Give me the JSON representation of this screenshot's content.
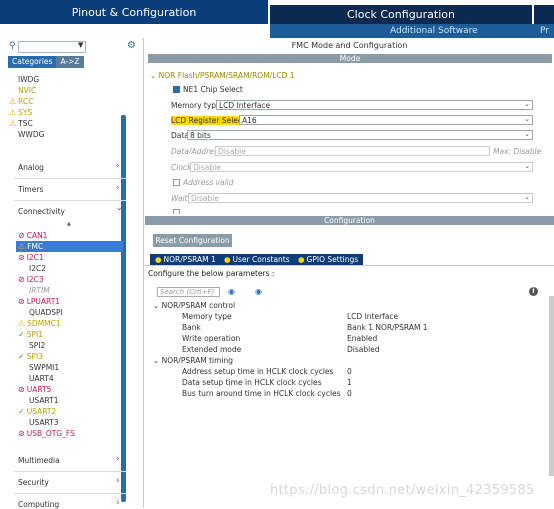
{
  "header": {
    "tab_pinout": "Pinout & Configuration",
    "tab_clock": "Clock Configuration",
    "additional_software": "Additional Software",
    "right_fragment": "Pr"
  },
  "left": {
    "cat_tab_a": "Categories",
    "cat_tab_b": "A->Z",
    "items_top": [
      "IWDG",
      "NVIC",
      "RCC",
      "SYS",
      "TSC",
      "WWDG"
    ],
    "categories": {
      "analog": "Analog",
      "timers": "Timers",
      "connectivity": "Connectivity",
      "multimedia": "Multimedia",
      "security": "Security",
      "computing": "Computing"
    },
    "connectivity_items": [
      "CAN1",
      "FMC",
      "I2C1",
      "I2C2",
      "I2C3",
      "IRTIM",
      "LPUART1",
      "QUADSPI",
      "SDMMC1",
      "SPI1",
      "SPI2",
      "SPI3",
      "SWPMI1",
      "UART4",
      "UART5",
      "USART1",
      "USART2",
      "USART3",
      "USB_OTG_FS"
    ]
  },
  "mode": {
    "title": "FMC Mode and Configuration",
    "bar": "Mode",
    "nor_header": "NOR Flash/PSRAM/SRAM/ROM/LCD 1",
    "ne1": "NE1 Chip Select",
    "memory_type_label": "Memory type",
    "memory_type_value": "LCD Interface",
    "lcd_reg_label": "LCD Register Select",
    "lcd_reg_value": "A16",
    "data_label": "Data",
    "data_value": "8 bits",
    "data_address_label": "Data/Address",
    "data_address_value": "Disable",
    "max_disable": "Max: Disable",
    "clock_label": "Clock",
    "clock_value": "Disable",
    "address_valid": "Address valid",
    "wait_label": "Wait",
    "wait_value": "Disable"
  },
  "config": {
    "bar": "Configuration",
    "reset_button": "Reset Configuration",
    "tabs": [
      "NOR/PSRAM 1",
      "User Constants",
      "GPIO Settings"
    ],
    "note": "Configure the below parameters :",
    "search_placeholder": "Search (Crtl+F)",
    "group_control": "NOR/PSRAM control",
    "group_timing": "NOR/PSRAM timing",
    "control_rows": [
      {
        "k": "Memory type",
        "v": "LCD Interface"
      },
      {
        "k": "Bank",
        "v": "Bank 1 NOR/PSRAM 1"
      },
      {
        "k": "Write operation",
        "v": "Enabled"
      },
      {
        "k": "Extended mode",
        "v": "Disabled"
      }
    ],
    "timing_rows": [
      {
        "k": "Address setup time in HCLK clock cycles",
        "v": "0"
      },
      {
        "k": "Data setup time in HCLK clock cycles",
        "v": "1"
      },
      {
        "k": "Bus turn around time in HCLK clock cycles",
        "v": "0"
      }
    ]
  },
  "watermark": "https://blog.csdn.net/weixin_42359585"
}
